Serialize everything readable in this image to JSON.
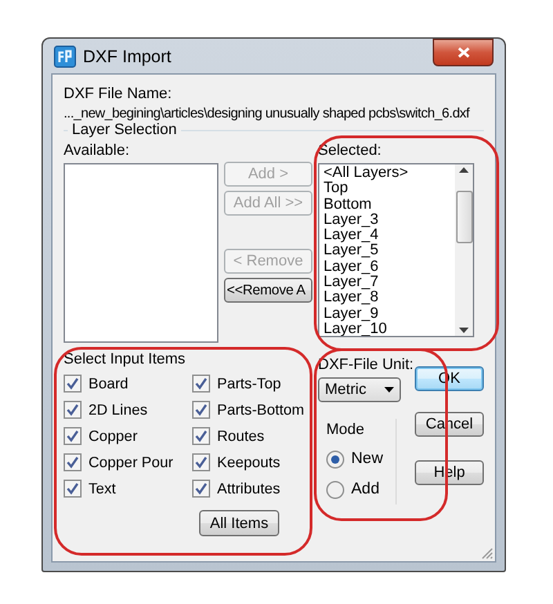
{
  "window": {
    "title": "DXF Import"
  },
  "file_name": {
    "label": "DXF File Name:",
    "path": "..._new_begining\\articles\\designing unusually shaped pcbs\\switch_6.dxf"
  },
  "layer_selection": {
    "title": "Layer Selection",
    "available_label": "Available:",
    "selected_label": "Selected:",
    "selected": [
      "<All Layers>",
      "Top",
      "Bottom",
      "Layer_3",
      "Layer_4",
      "Layer_5",
      "Layer_6",
      "Layer_7",
      "Layer_8",
      "Layer_9",
      "Layer_10"
    ],
    "buttons": [
      {
        "label": "Add >",
        "disabled": true
      },
      {
        "label": "Add All >>",
        "disabled": true
      },
      {
        "label": "< Remove",
        "disabled": true
      },
      {
        "label": "<<Remove A",
        "disabled": false
      }
    ]
  },
  "input_items": {
    "title": "Select Input Items",
    "items": [
      {
        "label": "Board",
        "checked": true
      },
      {
        "label": "Parts-Top",
        "checked": true
      },
      {
        "label": "2D Lines",
        "checked": true
      },
      {
        "label": "Parts-Bottom",
        "checked": true
      },
      {
        "label": "Copper",
        "checked": true
      },
      {
        "label": "Routes",
        "checked": true
      },
      {
        "label": "Copper Pour",
        "checked": true
      },
      {
        "label": "Keepouts",
        "checked": true
      },
      {
        "label": "Text",
        "checked": true
      },
      {
        "label": "Attributes",
        "checked": true
      }
    ],
    "button": "All Items"
  },
  "unit": {
    "label": "DXF-File Unit:",
    "value": "Metric"
  },
  "mode": {
    "title": "Mode",
    "options": [
      {
        "label": "New",
        "selected": true
      },
      {
        "label": "Add",
        "selected": false
      }
    ]
  },
  "buttons": [
    {
      "label": "OK",
      "default": true
    },
    {
      "label": "Cancel",
      "default": false
    },
    {
      "label": "Help",
      "default": false
    }
  ],
  "highlights": {
    "selected": true,
    "input_items": true,
    "unit": true
  }
}
